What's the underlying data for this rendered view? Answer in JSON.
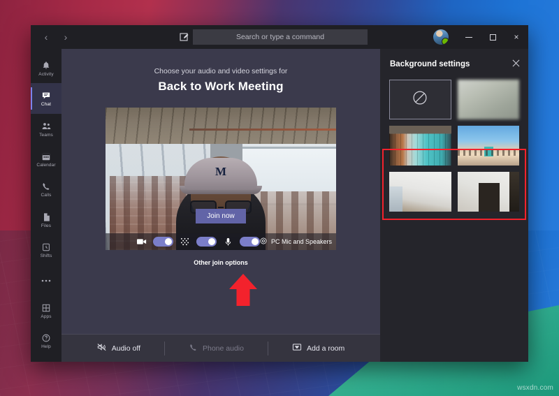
{
  "desktop": {
    "watermark": "wsxdn.com"
  },
  "window": {
    "titlebar": {
      "back_label": "‹",
      "forward_label": "›",
      "compose_icon": "compose-icon",
      "search_placeholder": "Search or type a command",
      "avatar_icon": "user-avatar",
      "minimize_label": "minimize",
      "maximize_label": "maximize",
      "close_label": "×"
    }
  },
  "sidebar": {
    "items": [
      {
        "label": "Activity",
        "icon": "bell-icon",
        "selected": false
      },
      {
        "label": "Chat",
        "icon": "chat-icon",
        "selected": true
      },
      {
        "label": "Teams",
        "icon": "teams-icon",
        "selected": false
      },
      {
        "label": "Calendar",
        "icon": "calendar-icon",
        "selected": false
      },
      {
        "label": "Calls",
        "icon": "phone-icon",
        "selected": false
      },
      {
        "label": "Files",
        "icon": "files-icon",
        "selected": false
      },
      {
        "label": "Shifts",
        "icon": "clock-icon",
        "selected": false
      },
      {
        "label": "",
        "icon": "more-ellipsis-icon",
        "selected": false
      }
    ],
    "bottom_items": [
      {
        "label": "Apps",
        "icon": "apps-icon"
      },
      {
        "label": "Help",
        "icon": "help-icon"
      }
    ]
  },
  "prejoin": {
    "subtitle": "Choose your audio and video settings for",
    "meeting_title": "Back to Work Meeting",
    "join_now_label": "Join now",
    "controls": {
      "camera_icon": "camera-icon",
      "camera_toggle_state": "on",
      "background_icon": "background-blur-icon",
      "background_toggle_state": "on",
      "mic_icon": "microphone-icon",
      "mic_toggle_state": "on",
      "device_gear_icon": "gear-icon",
      "device_label": "PC Mic and Speakers"
    },
    "other_join_options_label": "Other join options",
    "join_options": [
      {
        "label": "Audio off",
        "icon": "speaker-muted-icon",
        "disabled": false
      },
      {
        "label": "Phone audio",
        "icon": "phone-icon",
        "disabled": true
      },
      {
        "label": "Add a room",
        "icon": "room-icon",
        "disabled": false
      }
    ]
  },
  "background_panel": {
    "title": "Background settings",
    "close_icon": "close-icon",
    "thumbnails": [
      {
        "name": "none",
        "icon": "no-background-icon",
        "selected": true
      },
      {
        "name": "blur",
        "icon": "blur-icon",
        "selected": false
      },
      {
        "name": "office-teal-wall",
        "icon": "image-thumbnail",
        "selected": false
      },
      {
        "name": "beach-lifeguard-tower",
        "icon": "image-thumbnail",
        "selected": false
      },
      {
        "name": "white-room",
        "icon": "image-thumbnail",
        "selected": false
      },
      {
        "name": "doorway-interior",
        "icon": "image-thumbnail",
        "selected": false
      }
    ],
    "highlight_color": "#f3222c"
  },
  "annotations": {
    "arrow_color": "#f3222c",
    "arrow_direction": "up"
  },
  "colors": {
    "accent": "#6264a7",
    "toggle_on": "#7b7ec9",
    "presence_available": "#6bb700",
    "window_chrome": "#1f1f24",
    "main_bg": "#3b3a4c",
    "panel_bg": "#25252b"
  }
}
